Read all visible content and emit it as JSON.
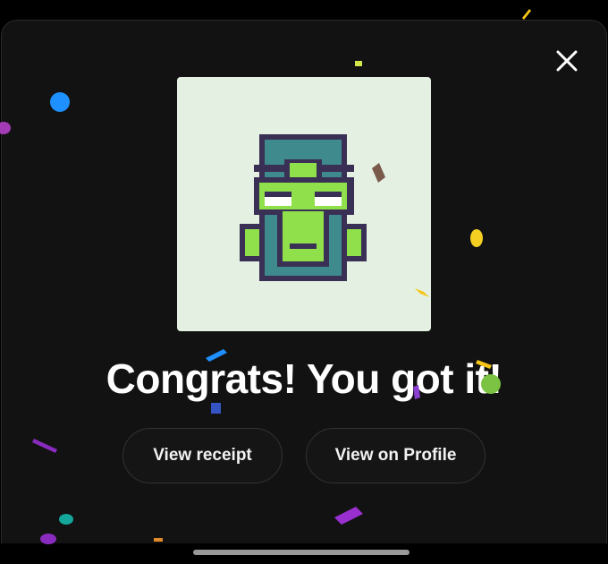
{
  "modal": {
    "headline": "Congrats! You got it!",
    "close_label": "Close",
    "artwork_alt": "Pixel mask avatar"
  },
  "actions": {
    "view_receipt": "View receipt",
    "view_profile": "View on Profile"
  },
  "icons": {
    "close": "close-icon",
    "artwork": "pixel-mask-icon",
    "confetti": "confetti-decoration"
  },
  "colors": {
    "sheet_background": "#121212",
    "artwork_background": "#e4f1e2",
    "mask_outline": "#3a2f55",
    "mask_teal": "#3e8a8c",
    "mask_green": "#8fe04a",
    "text": "#ffffff"
  }
}
